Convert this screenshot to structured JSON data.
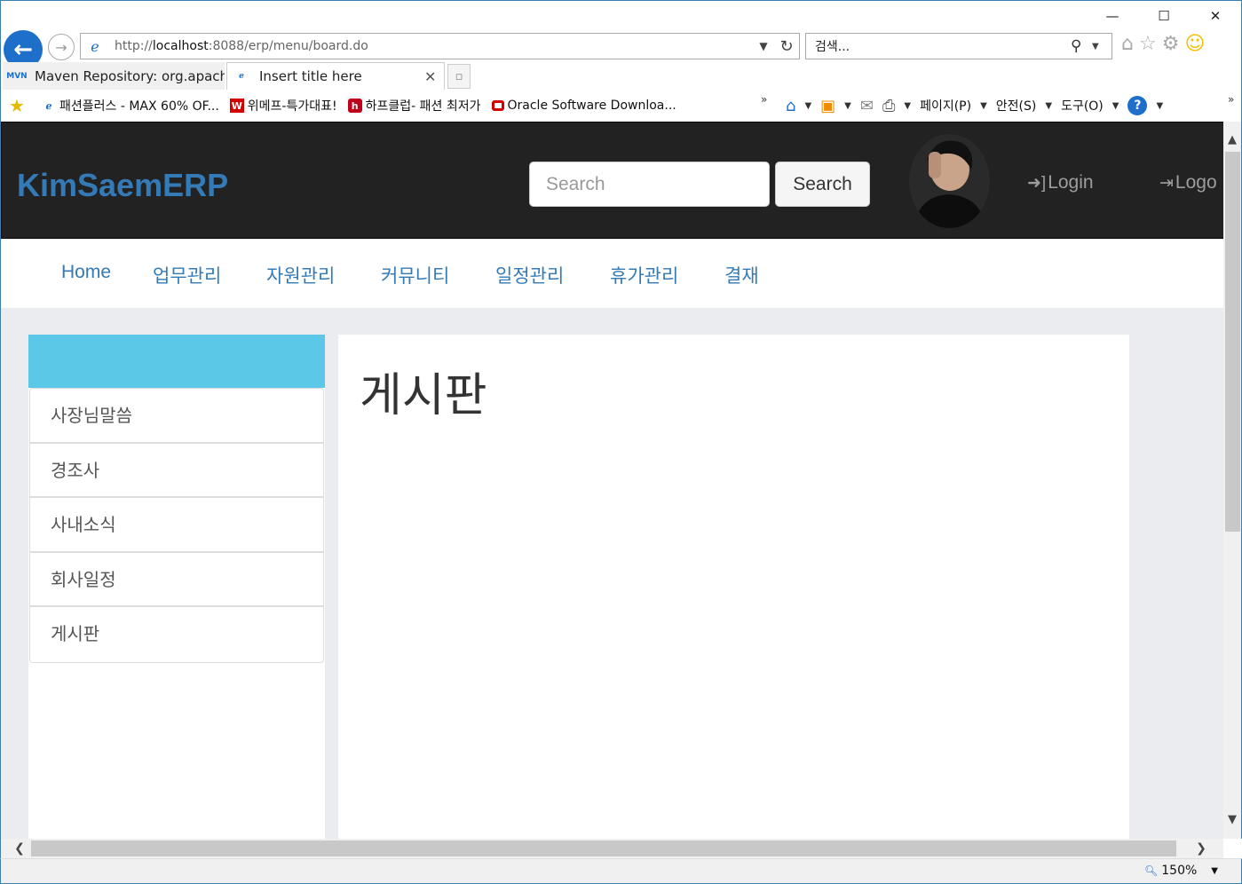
{
  "browser": {
    "window_controls": {
      "minimize": "—",
      "maximize": "☐",
      "close": "✕"
    },
    "address_prefix": "http://",
    "address_host": "localhost",
    "address_rest": ":8088/erp/menu/board.do",
    "search_placeholder": "검색...",
    "tabs": [
      {
        "label": "Maven Repository: org.apache...",
        "icon": "MVN",
        "active": false
      },
      {
        "label": "Insert title here",
        "icon": "ie-icon",
        "active": true
      }
    ],
    "favorites": [
      {
        "label": "패션플러스 - MAX 60% OF...",
        "icon": "ie-icon"
      },
      {
        "label": "위메프-특가대표!",
        "icon": "W"
      },
      {
        "label": "하프클럽- 패션 최저가",
        "icon": "h"
      },
      {
        "label": "Oracle Software Downloa...",
        "icon": "oracle-icon"
      }
    ],
    "command_bar": {
      "page": "페이지(P)",
      "safety": "안전(S)",
      "tools": "도구(O)"
    },
    "zoom": "150%"
  },
  "navbar": {
    "brand": "KimSaemERP",
    "search_placeholder": "Search",
    "search_button": "Search",
    "login": "Login",
    "logout": "Logo"
  },
  "menu": {
    "items": [
      "Home",
      "업무관리",
      "자원관리",
      "커뮤니티",
      "일정관리",
      "휴가관리",
      "결재"
    ]
  },
  "sidebar": {
    "header_color": "#5bc8e8",
    "items": [
      "사장님말씀",
      "경조사",
      "사내소식",
      "회사일정",
      "게시판"
    ]
  },
  "content": {
    "title": "게시판"
  },
  "colors": {
    "brand": "#337ab7",
    "navbar_bg": "#222222",
    "page_bg": "#ebecef"
  }
}
